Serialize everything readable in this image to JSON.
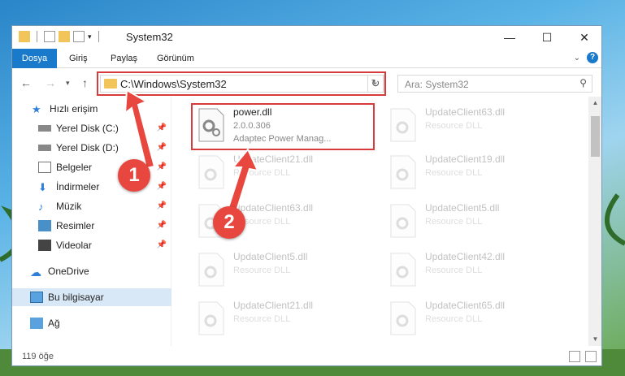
{
  "window": {
    "title": "System32"
  },
  "ribbon": {
    "tabs": [
      "Dosya",
      "Giriş",
      "Paylaş",
      "Görünüm"
    ]
  },
  "nav": {
    "path": "C:\\Windows\\System32",
    "search_placeholder": "Ara: System32"
  },
  "sidebar": {
    "items": [
      {
        "label": "Hızlı erişim"
      },
      {
        "label": "Yerel Disk (C:)"
      },
      {
        "label": "Yerel Disk (D:)"
      },
      {
        "label": "Belgeler"
      },
      {
        "label": "İndirmeler"
      },
      {
        "label": "Müzik"
      },
      {
        "label": "Resimler"
      },
      {
        "label": "Videolar"
      },
      {
        "label": "OneDrive"
      },
      {
        "label": "Bu bilgisayar"
      },
      {
        "label": "Ağ"
      }
    ]
  },
  "files": {
    "highlighted": {
      "name": "power.dll",
      "version": "2.0.0.306",
      "desc": "Adaptec Power Manag..."
    },
    "left": [
      {
        "name": "UpdateClient21.dll",
        "type": "Resource DLL"
      },
      {
        "name": "UpdateClient63.dll",
        "type": "Resource DLL"
      },
      {
        "name": "UpdateClient5.dll",
        "type": "Resource DLL"
      },
      {
        "name": "UpdateClient21.dll",
        "type": "Resource DLL"
      }
    ],
    "right": [
      {
        "name": "UpdateClient63.dll",
        "type": "Resource DLL"
      },
      {
        "name": "UpdateClient19.dll",
        "type": "Resource DLL"
      },
      {
        "name": "UpdateClient5.dll",
        "type": "Resource DLL"
      },
      {
        "name": "UpdateClient42.dll",
        "type": "Resource DLL"
      },
      {
        "name": "UpdateClient65.dll",
        "type": "Resource DLL"
      }
    ]
  },
  "status": {
    "count": "119 öğe"
  },
  "markers": {
    "one": "1",
    "two": "2"
  }
}
